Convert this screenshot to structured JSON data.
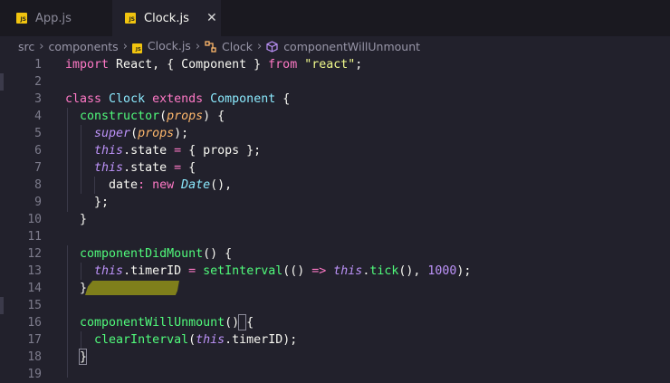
{
  "tabs": [
    {
      "label": "App.js",
      "active": false,
      "icon": "js-file-icon"
    },
    {
      "label": "Clock.js",
      "active": true,
      "icon": "js-file-icon",
      "close": "✕"
    }
  ],
  "file_icon_text": "JS",
  "breadcrumb": {
    "items": [
      "src",
      "components",
      "Clock.js",
      "Clock",
      "componentWillUnmount"
    ]
  },
  "lines": [
    {
      "n": "1",
      "parts": [
        [
          "k-pink",
          "import"
        ],
        [
          "k-prop",
          " React, { Component } "
        ],
        [
          "k-pink",
          "from"
        ],
        [
          "k-prop",
          " "
        ],
        [
          "k-str",
          "\"react\""
        ],
        [
          "k-prop",
          ";"
        ]
      ]
    },
    {
      "n": "2",
      "parts": []
    },
    {
      "n": "3",
      "parts": [
        [
          "k-pink",
          "class"
        ],
        [
          "k-prop",
          " "
        ],
        [
          "k-cls",
          "Clock"
        ],
        [
          "k-prop",
          " "
        ],
        [
          "k-pink",
          "extends"
        ],
        [
          "k-prop",
          " "
        ],
        [
          "k-cls",
          "Component"
        ],
        [
          "k-prop",
          " {"
        ]
      ]
    },
    {
      "n": "4",
      "parts": [
        [
          "k-prop",
          "  "
        ],
        [
          "k-fn",
          "constructor"
        ],
        [
          "k-prop",
          "("
        ],
        [
          "k-param",
          "props"
        ],
        [
          "k-prop",
          ") {"
        ]
      ]
    },
    {
      "n": "5",
      "parts": [
        [
          "k-prop",
          "    "
        ],
        [
          "k-this",
          "super"
        ],
        [
          "k-prop",
          "("
        ],
        [
          "k-param",
          "props"
        ],
        [
          "k-prop",
          ");"
        ]
      ]
    },
    {
      "n": "6",
      "parts": [
        [
          "k-prop",
          "    "
        ],
        [
          "k-this",
          "this"
        ],
        [
          "k-prop",
          ".state "
        ],
        [
          "k-pink",
          "="
        ],
        [
          "k-prop",
          " { props };"
        ]
      ]
    },
    {
      "n": "7",
      "parts": [
        [
          "k-prop",
          "    "
        ],
        [
          "k-this",
          "this"
        ],
        [
          "k-prop",
          ".state "
        ],
        [
          "k-pink",
          "="
        ],
        [
          "k-prop",
          " {"
        ]
      ]
    },
    {
      "n": "8",
      "parts": [
        [
          "k-prop",
          "      date"
        ],
        [
          "k-pink",
          ":"
        ],
        [
          "k-prop",
          " "
        ],
        [
          "k-pink",
          "new"
        ],
        [
          "k-prop",
          " "
        ],
        [
          "k-italic-cls",
          "Date"
        ],
        [
          "k-prop",
          "(),"
        ]
      ]
    },
    {
      "n": "9",
      "parts": [
        [
          "k-prop",
          "    };"
        ]
      ]
    },
    {
      "n": "10",
      "parts": [
        [
          "k-prop",
          "  }"
        ]
      ]
    },
    {
      "n": "11",
      "parts": []
    },
    {
      "n": "12",
      "parts": [
        [
          "k-prop",
          "  "
        ],
        [
          "k-fn",
          "componentDidMount"
        ],
        [
          "k-prop",
          "() {"
        ]
      ]
    },
    {
      "n": "13",
      "parts": [
        [
          "k-prop",
          "    "
        ],
        [
          "k-this",
          "this"
        ],
        [
          "k-prop",
          ".timerID "
        ],
        [
          "k-pink",
          "="
        ],
        [
          "k-prop",
          " "
        ],
        [
          "k-fn",
          "setInterval"
        ],
        [
          "k-prop",
          "(() "
        ],
        [
          "k-pink",
          "=>"
        ],
        [
          "k-prop",
          " "
        ],
        [
          "k-this",
          "this"
        ],
        [
          "k-prop",
          "."
        ],
        [
          "k-fn",
          "tick"
        ],
        [
          "k-prop",
          "(), "
        ],
        [
          "k-num",
          "1000"
        ],
        [
          "k-prop",
          ");"
        ]
      ]
    },
    {
      "n": "14",
      "parts": [
        [
          "k-prop",
          "  }"
        ]
      ]
    },
    {
      "n": "15",
      "parts": []
    },
    {
      "n": "16",
      "parts": [
        [
          "k-prop",
          "  "
        ],
        [
          "k-fn",
          "componentWillUnmount"
        ],
        [
          "k-prop",
          "() {"
        ]
      ]
    },
    {
      "n": "17",
      "parts": [
        [
          "k-prop",
          "    "
        ],
        [
          "k-fn",
          "clearInterval"
        ],
        [
          "k-prop",
          "("
        ],
        [
          "k-this",
          "this"
        ],
        [
          "k-prop",
          ".timerID);"
        ]
      ]
    },
    {
      "n": "18",
      "parts": [
        [
          "k-prop",
          "  }"
        ]
      ]
    },
    {
      "n": "19",
      "parts": []
    }
  ],
  "colors": {
    "background": "#22212c",
    "tabbar": "#1a1920",
    "keyword": "#ff79c6",
    "class": "#8be9fd",
    "function": "#50fa7b",
    "param": "#ffb86c",
    "this": "#bd93f9",
    "string": "#f1fa8c",
    "highlight": "#8a8a1a"
  }
}
